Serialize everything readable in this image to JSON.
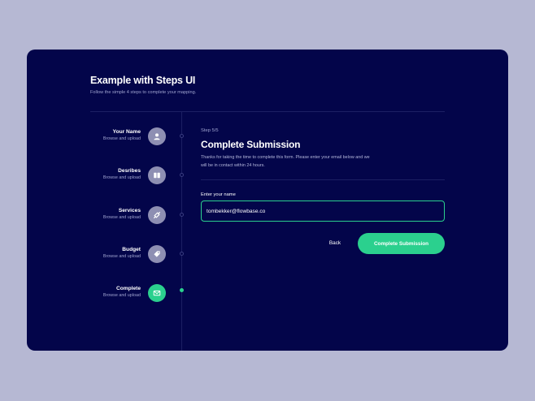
{
  "header": {
    "title": "Example with Steps UI",
    "subtitle": "Follow the simple 4 steps to complete your mapping."
  },
  "steps": [
    {
      "name": "Your Name",
      "description": "Browse and upload",
      "icon": "user-icon",
      "active": false
    },
    {
      "name": "Desribes",
      "description": "Browse and upload",
      "icon": "book-icon",
      "active": false
    },
    {
      "name": "Services",
      "description": "Browse and upload",
      "icon": "link-icon",
      "active": false
    },
    {
      "name": "Budget",
      "description": "Browse and upload",
      "icon": "tag-icon",
      "active": false
    },
    {
      "name": "Complete",
      "description": "Browse and upload",
      "icon": "mail-icon",
      "active": true
    }
  ],
  "main": {
    "step_label": "Step 5/5",
    "title": "Complete Submission",
    "description": "Thanks for taking the time to complete this form. Please enter your email below and we will be in contact within 24 hours.",
    "field_label": "Enter your name",
    "field_value": "tombekker@flowbase.co",
    "back_label": "Back",
    "submit_label": "Complete Submission"
  },
  "colors": {
    "page_background": "#b6b8d3",
    "card_background": "#03054a",
    "accent": "#2bd08e",
    "inactive_step": "#8e8fb3",
    "muted_text": "#9fa3cf"
  }
}
